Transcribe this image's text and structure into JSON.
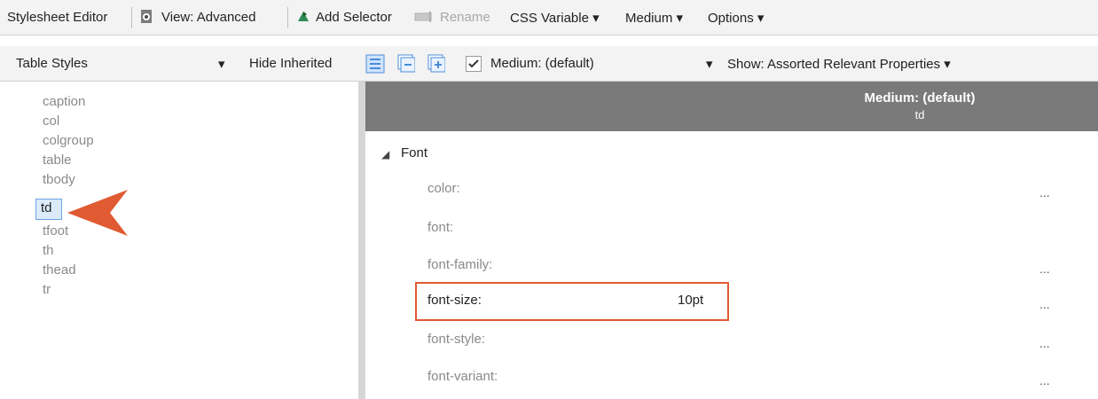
{
  "toolbar1": {
    "title": "Stylesheet Editor",
    "view": "View: Advanced",
    "add_selector": "Add Selector",
    "rename": "Rename",
    "css_variable": "CSS Variable",
    "medium": "Medium",
    "options": "Options"
  },
  "toolbar2": {
    "dropdown": "Table Styles",
    "hide_inherited": "Hide Inherited",
    "medium_checkbox": "Medium: (default)",
    "show": "Show: Assorted Relevant Properties"
  },
  "tree": {
    "items": [
      "caption",
      "col",
      "colgroup",
      "table",
      "tbody",
      "td",
      "tfoot",
      "th",
      "thead",
      "tr"
    ],
    "selected": "td"
  },
  "properties": {
    "header_title": "Medium: (default)",
    "header_sub": "td",
    "group": "Font",
    "rows": [
      {
        "name": "color:",
        "value": "",
        "dots": "..."
      },
      {
        "name": "font:",
        "value": "",
        "dots": ""
      },
      {
        "name": "font-family:",
        "value": "",
        "dots": "..."
      },
      {
        "name": "font-size:",
        "value": "10pt",
        "dots": "..."
      },
      {
        "name": "font-style:",
        "value": "",
        "dots": "..."
      },
      {
        "name": "font-variant:",
        "value": "",
        "dots": "..."
      }
    ]
  },
  "colors": {
    "accent": "#e05a32",
    "header_bg": "#7a7a7a",
    "selection": "#dcebfb"
  }
}
